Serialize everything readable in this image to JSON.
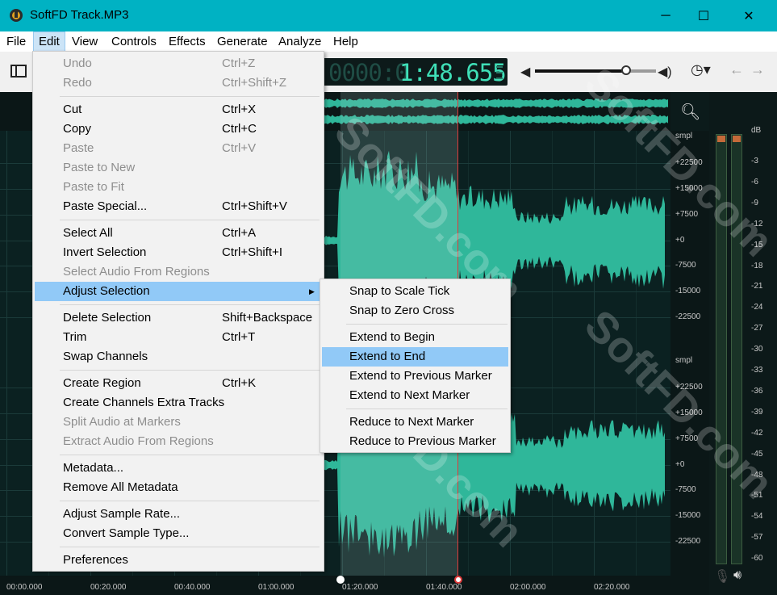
{
  "window": {
    "title": "SoftFD Track.MP3",
    "minimize_glyph": "─",
    "maximize_glyph": "☐",
    "close_glyph": "✕",
    "icon": "app-logo-icon"
  },
  "menubar": {
    "items": [
      {
        "label": "File"
      },
      {
        "label": "Edit"
      },
      {
        "label": "View"
      },
      {
        "label": "Controls"
      },
      {
        "label": "Effects"
      },
      {
        "label": "Generate"
      },
      {
        "label": "Analyze"
      },
      {
        "label": "Help"
      }
    ],
    "active": "Edit"
  },
  "toolbar": {
    "timecode_ghost": "0000:0",
    "timecode": "1:48.655",
    "volume_level": 0.75,
    "icons": [
      "sidebar-toggle-icon",
      "volume-icon",
      "volume-max-icon",
      "clock-icon",
      "back-arrow-icon",
      "forward-arrow-icon"
    ]
  },
  "edit_menu": {
    "items": [
      {
        "label": "Undo",
        "shortcut": "Ctrl+Z",
        "disabled": true
      },
      {
        "label": "Redo",
        "shortcut": "Ctrl+Shift+Z",
        "disabled": true
      },
      {
        "label": "Cut",
        "shortcut": "Ctrl+X"
      },
      {
        "label": "Copy",
        "shortcut": "Ctrl+C"
      },
      {
        "label": "Paste",
        "shortcut": "Ctrl+V",
        "disabled": true
      },
      {
        "label": "Paste to New",
        "shortcut": "",
        "disabled": true
      },
      {
        "label": "Paste to Fit",
        "shortcut": "",
        "disabled": true
      },
      {
        "label": "Paste Special...",
        "shortcut": "Ctrl+Shift+V"
      },
      {
        "label": "Select All",
        "shortcut": "Ctrl+A"
      },
      {
        "label": "Invert Selection",
        "shortcut": "Ctrl+Shift+I"
      },
      {
        "label": "Select Audio From Regions",
        "shortcut": "",
        "disabled": true
      },
      {
        "label": "Adjust Selection",
        "shortcut": "",
        "submenu": true,
        "highlighted": true
      },
      {
        "label": "Delete Selection",
        "shortcut": "Shift+Backspace"
      },
      {
        "label": "Trim",
        "shortcut": "Ctrl+T"
      },
      {
        "label": "Swap Channels",
        "shortcut": ""
      },
      {
        "label": "Create Region",
        "shortcut": "Ctrl+K"
      },
      {
        "label": "Create Channels Extra Tracks",
        "shortcut": ""
      },
      {
        "label": "Split Audio at Markers",
        "shortcut": "",
        "disabled": true
      },
      {
        "label": "Extract Audio From Regions",
        "shortcut": "",
        "disabled": true
      },
      {
        "label": "Metadata...",
        "shortcut": ""
      },
      {
        "label": "Remove All Metadata",
        "shortcut": ""
      },
      {
        "label": "Adjust Sample Rate...",
        "shortcut": ""
      },
      {
        "label": "Convert Sample Type...",
        "shortcut": ""
      },
      {
        "label": "Preferences",
        "shortcut": ""
      }
    ],
    "submenu_arrow": "▶"
  },
  "adjust_submenu": {
    "items": [
      {
        "label": "Snap to Scale Tick"
      },
      {
        "label": "Snap to Zero Cross"
      },
      {
        "label": "Extend to Begin"
      },
      {
        "label": "Extend to End",
        "highlighted": true
      },
      {
        "label": "Extend to Previous Marker"
      },
      {
        "label": "Extend to Next Marker"
      },
      {
        "label": "Reduce to Next Marker"
      },
      {
        "label": "Reduce to Previous Marker"
      }
    ]
  },
  "scale": {
    "top": {
      "unit": "smpl",
      "ticks": [
        "+22500",
        "+15000",
        "+7500",
        "+0",
        "-7500",
        "-15000",
        "-22500"
      ]
    },
    "bottom": {
      "unit": "smpl",
      "ticks": [
        "+22500",
        "+15000",
        "+7500",
        "+0",
        "-7500",
        "-15000",
        "-22500"
      ]
    }
  },
  "meter": {
    "unit": "dB",
    "ticks": [
      "-3",
      "-6",
      "-9",
      "-12",
      "-15",
      "-18",
      "-21",
      "-24",
      "-27",
      "-30",
      "-33",
      "-36",
      "-39",
      "-42",
      "-45",
      "-48",
      "-51",
      "-54",
      "-57",
      "-60"
    ]
  },
  "timeline": {
    "labels": [
      "00:00.000",
      "00:20.000",
      "00:40.000",
      "01:00.000",
      "01:20.000",
      "01:40.000",
      "02:00.000",
      "02:20.000"
    ]
  },
  "waveform": {
    "color": "#2fb79a",
    "selection_start": "01:20.000",
    "playhead": "01:48.655"
  },
  "watermark": "SoftFD.com",
  "colors": {
    "titlebar": "#00b2c3",
    "menu_highlight": "#91c9f7",
    "timecode_text": "#3fe0b8",
    "playhead": "#e03a3a",
    "waveform": "#2fb79a"
  }
}
